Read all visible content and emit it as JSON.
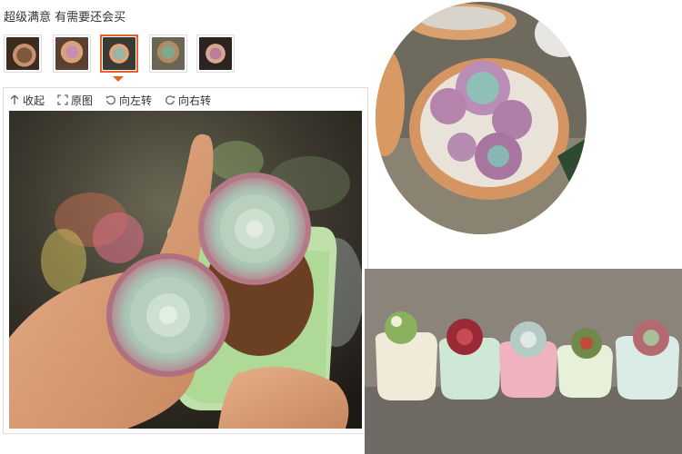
{
  "review": {
    "text": "超级满意 有需要还会买"
  },
  "thumbnails": [
    {
      "name": "thumb-1",
      "active": false
    },
    {
      "name": "thumb-2",
      "active": false
    },
    {
      "name": "thumb-3",
      "active": true
    },
    {
      "name": "thumb-4",
      "active": false
    },
    {
      "name": "thumb-5",
      "active": false
    }
  ],
  "toolbar": {
    "collapse_label": "收起",
    "original_label": "原图",
    "rotate_left_label": "向左转",
    "rotate_right_label": "向右转"
  },
  "icons": {
    "collapse": "arrow-up-icon",
    "original": "expand-icon",
    "rotate_left": "rotate-left-icon",
    "rotate_right": "rotate-right-icon"
  },
  "colors": {
    "accent": "#e8612b"
  }
}
